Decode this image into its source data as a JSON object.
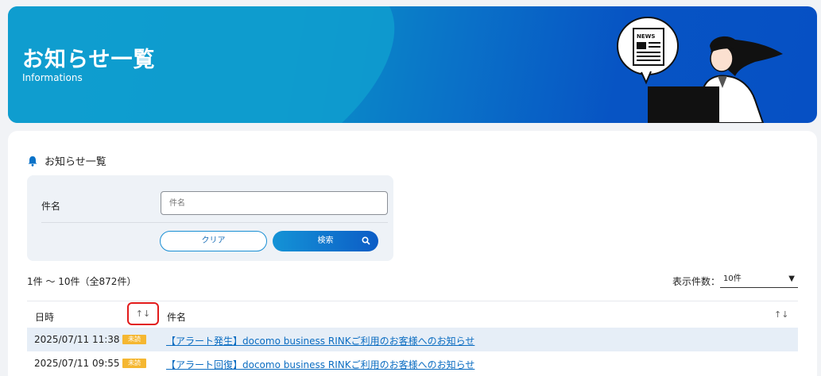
{
  "header": {
    "title": "お知らせ一覧",
    "subtitle": "Informations",
    "illustration_label": "NEWS"
  },
  "section": {
    "title": "お知らせ一覧",
    "icon": "bell-icon"
  },
  "search": {
    "label": "件名",
    "placeholder": "件名",
    "clear_label": "クリア",
    "search_label": "検索"
  },
  "results": {
    "count_text": "1件 ～ 10件（全872件）",
    "per_page_label": "表示件数：",
    "per_page_value": "10件"
  },
  "table": {
    "headers": {
      "date": "日時",
      "subject": "件名"
    },
    "sort_symbol": "↑↓",
    "rows": [
      {
        "date": "2025/07/11 11:38",
        "badge": "未読",
        "subject": "【アラート発生】docomo business RINKご利用のお客様へのお知らせ"
      },
      {
        "date": "2025/07/11 09:55",
        "badge": "未読",
        "subject": "【アラート回復】docomo business RINKご利用のお客様へのお知らせ"
      }
    ]
  },
  "colors": {
    "accent": "#0a6cc1",
    "badge": "#f5b731",
    "highlight": "#e21b1b"
  }
}
